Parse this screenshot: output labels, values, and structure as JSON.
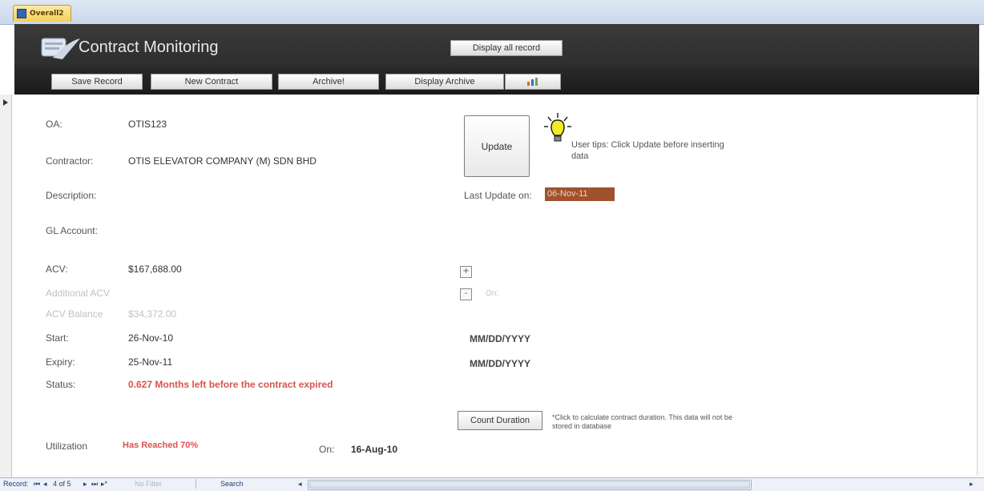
{
  "tab": {
    "label": "Overall2"
  },
  "header": {
    "title": "Contract Monitoring",
    "display_all_label": "Display all record"
  },
  "toolbar": {
    "save_label": "Save Record",
    "new_label": "New Contract",
    "archive_label": "Archive!",
    "display_archive_label": "Display Archive"
  },
  "form": {
    "oa_label": "OA:",
    "oa_value": "OTIS123",
    "contractor_label": "Contractor:",
    "contractor_value": "OTIS ELEVATOR COMPANY (M) SDN BHD",
    "description_label": "Description:",
    "gl_label": "GL Account:",
    "acv_label": "ACV:",
    "acv_value": "$167,688.00",
    "additional_acv_label": "Additional ACV",
    "acv_balance_label": "ACV Balance",
    "acv_balance_value": "$34,372.00",
    "start_label": "Start:",
    "start_value": "26-Nov-10",
    "expiry_label": "Expiry:",
    "expiry_value": "25-Nov-11",
    "status_label": "Status:",
    "status_value": "0.627 Months left before the contract expired",
    "utilization_label": "Utilization",
    "utilization_value": "Has Reached 70%",
    "on_label": "On:",
    "on_value": "16-Aug-10"
  },
  "side": {
    "update_label": "Update",
    "tip_text": "User tips: Click Update before inserting data",
    "last_update_label": "Last Update on:",
    "last_update_value": "06-Nov-11",
    "plus_symbol": "+",
    "minus_symbol": "-",
    "on_small": "On:",
    "start_placeholder": "MM/DD/YYYY",
    "expiry_placeholder": "MM/DD/YYYY",
    "count_label": "Count Duration",
    "count_note": "*Click to calculate contract duration. This data will not be stored in database"
  },
  "statusbar": {
    "record_label": "Record:",
    "record_value": "4 of 5",
    "filter_label": "No Filter",
    "search_label": "Search"
  },
  "colors": {
    "header_bg": "#2c2c2c",
    "date_fill": "#a0522d",
    "status_red": "#d9534f",
    "tab_yellow": "#f3cf5b"
  }
}
